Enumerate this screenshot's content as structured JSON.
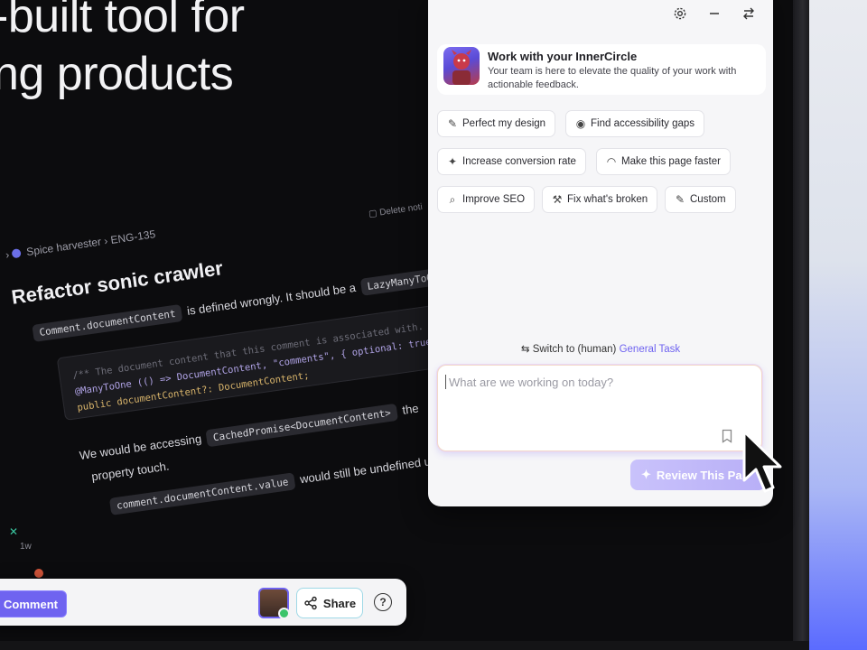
{
  "hero": {
    "line1": "-built tool for",
    "line2": "ng products"
  },
  "issue": {
    "delete_note": "Delete noti",
    "breadcrumb_project": "Spice harvester",
    "breadcrumb_sep": "›",
    "breadcrumb_id": "ENG-135",
    "title": "Refactor sonic crawler",
    "para1_chip": "Comment.documentContent",
    "para1_text": "is defined wrongly. It should be a",
    "para1_chip2": "LazyManyToOne",
    "code_line1": "/** The document content that this comment is associated with. */",
    "code_line2": "@ManyToOne (() => DocumentContent, \"comments\", { optional: true,",
    "code_line3": "public documentContent?: DocumentContent;",
    "para2_text": "We would be accessing",
    "para2_chip": "CachedPromise<DocumentContent>",
    "para2_tail": "the",
    "para3_text": "property touch.",
    "para3_lead": "would still be undefined u",
    "para4_chip": "comment.documentContent.value",
    "side_time": "1w"
  },
  "toolbar": {
    "comment_label": "Comment",
    "share_label": "Share",
    "help_label": "?"
  },
  "panel": {
    "header_icons": [
      "gear-icon",
      "minimize-icon",
      "swap-icon"
    ],
    "intro_title": "Work with your InnerCircle",
    "intro_text": "Your team is here to elevate the quality of your work with actionable feedback.",
    "suggestions": [
      {
        "label": "Perfect my design",
        "icon": "pencil-icon"
      },
      {
        "label": "Find accessibility gaps",
        "icon": "eye-icon"
      },
      {
        "label": "Increase conversion rate",
        "icon": "sparkle-icon"
      },
      {
        "label": "Make this page faster",
        "icon": "speedometer-icon"
      },
      {
        "label": "Improve SEO",
        "icon": "search-icon"
      },
      {
        "label": "Fix what's broken",
        "icon": "wrench-icon"
      },
      {
        "label": "Custom",
        "icon": "pencil-icon"
      }
    ],
    "switch_text": "Switch to (human)",
    "switch_link": "General Task",
    "prompt_placeholder": "What are we working on today?",
    "review_label": "Review This Pa"
  },
  "colors": {
    "accent": "#6f63f0",
    "panel_bg": "#f6f6f8",
    "page_bg": "#0c0c0e"
  }
}
